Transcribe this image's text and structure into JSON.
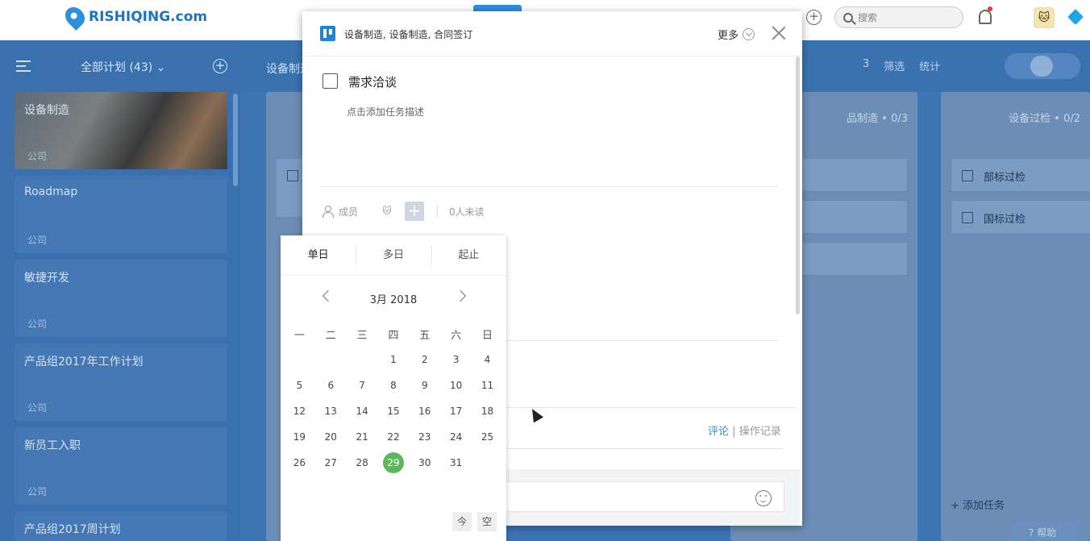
{
  "topbar": {
    "brand": "RISHIQING.com",
    "search_placeholder": "搜索"
  },
  "sidebar": {
    "title": "全部计划 (43) ⌄",
    "plans": [
      {
        "name": "设备制造",
        "tag": "公司"
      },
      {
        "name": "Roadmap",
        "tag": "公司"
      },
      {
        "name": "敏捷开发",
        "tag": "公司"
      },
      {
        "name": "产品组2017年工作计划",
        "tag": "公司"
      },
      {
        "name": "新员工入职",
        "tag": "公司"
      },
      {
        "name": "产品组2017周计划",
        "tag": ""
      }
    ]
  },
  "board": {
    "title": "设备制造",
    "tools": {
      "members": "3",
      "filter": "筛选",
      "stats": "统计"
    },
    "columns": [
      {
        "header": "品制造 • 0/3",
        "tasks": []
      },
      {
        "header": "设备过检 • 0/2",
        "tasks": [
          "部标过检",
          "国标过检"
        ],
        "add_label": "添加任务"
      }
    ],
    "help": "帮助"
  },
  "modal": {
    "path": "设备制造, 设备制造, 合同签订",
    "more_label": "更多",
    "task_title": "需求洽谈",
    "task_desc_placeholder": "点击添加任务描述",
    "members_label": "成员",
    "unread_label": "0人未读",
    "comment_tab": "评论",
    "log_tab": "操作记录",
    "tab_sep": "|"
  },
  "datepicker": {
    "tabs": [
      "单日",
      "多日",
      "起止"
    ],
    "active_tab": "单日",
    "month_label": "3月 2018",
    "weekdays": [
      "一",
      "二",
      "三",
      "四",
      "五",
      "六",
      "日"
    ],
    "weeks": [
      [
        "",
        "",
        "",
        "1",
        "2",
        "3",
        "4"
      ],
      [
        "5",
        "6",
        "7",
        "8",
        "9",
        "10",
        "11"
      ],
      [
        "12",
        "13",
        "14",
        "15",
        "16",
        "17",
        "18"
      ],
      [
        "19",
        "20",
        "21",
        "22",
        "23",
        "24",
        "25"
      ],
      [
        "26",
        "27",
        "28",
        "29",
        "30",
        "31",
        ""
      ]
    ],
    "selected_day": "29",
    "today_btn": "今",
    "clear_btn": "空",
    "selected_color": "#5cb85c"
  }
}
